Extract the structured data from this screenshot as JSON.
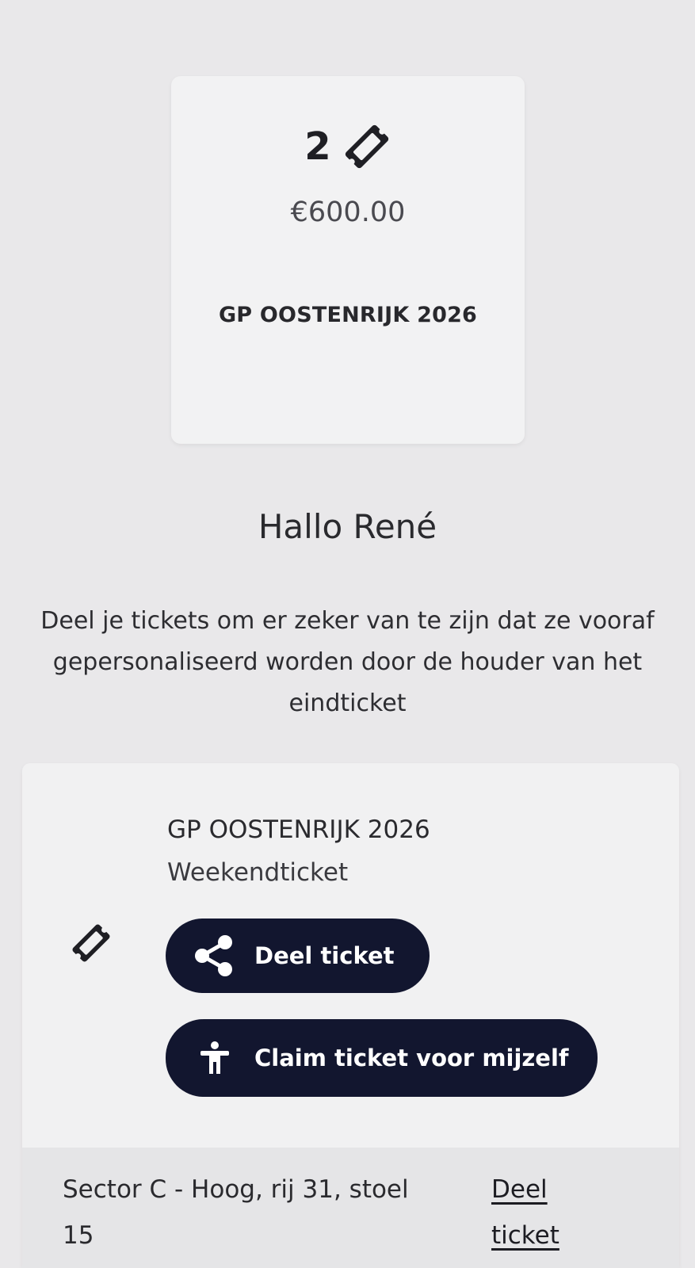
{
  "summary": {
    "ticket_count": "2",
    "price": "€600.00",
    "event_title": "GP OOSTENRIJK 2026"
  },
  "greeting": "Hallo René",
  "intro_text": "Deel je tickets om er zeker van te zijn dat ze vooraf gepersonaliseerd worden door de houder van het eindticket",
  "ticket": {
    "event_title": "GP OOSTENRIJK 2026",
    "type": "Weekendticket",
    "share_button_label": "Deel ticket",
    "claim_button_label": "Claim ticket voor mijzelf",
    "seat": "Sector C - Hoog, rij 31, stoel 15",
    "seat_share_link": "Deel ticket"
  },
  "icons": {
    "ticket": "ticket-icon",
    "share": "share-icon",
    "person": "person-icon"
  },
  "colors": {
    "button_bg": "#12162f",
    "page_bg": "#e9e8ea",
    "card_bg": "#f2f2f3"
  }
}
